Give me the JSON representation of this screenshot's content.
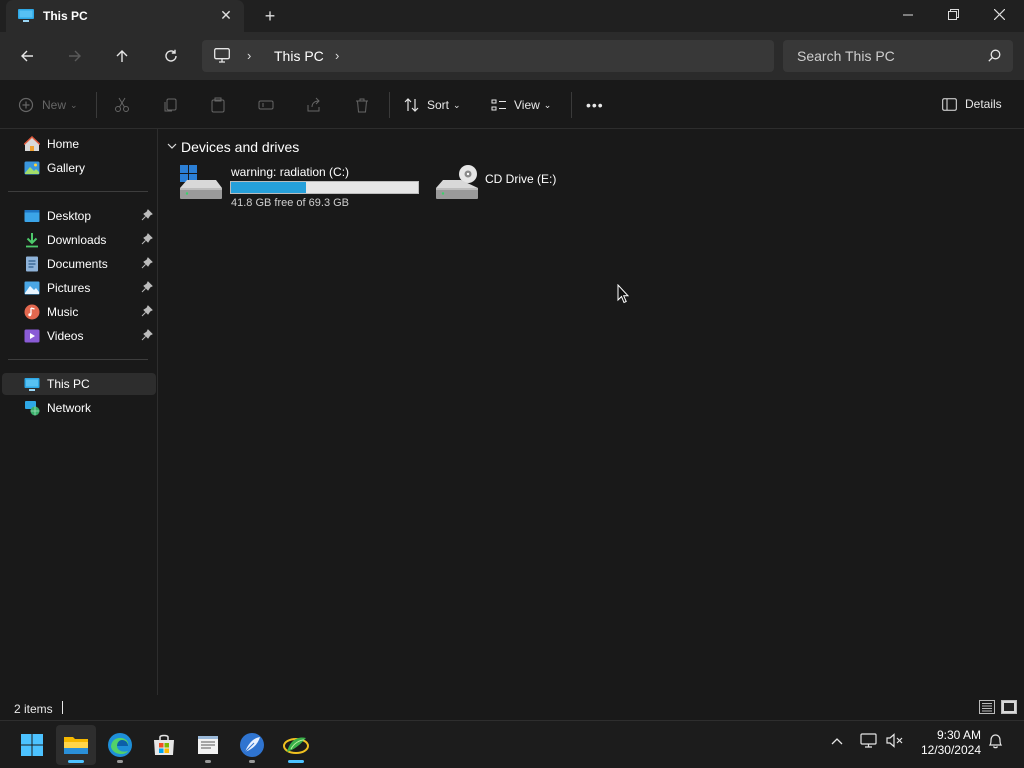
{
  "window": {
    "tab_title": "This PC",
    "tab_close": "✕",
    "new_tab": "+",
    "minimize": "—",
    "restore": "❐",
    "close": "✕"
  },
  "address": {
    "crumb": "This PC",
    "search_placeholder": "Search This PC"
  },
  "commands": {
    "new_label": "New",
    "sort_label": "Sort",
    "view_label": "View",
    "details_label": "Details",
    "more_label": "•••"
  },
  "sidebar": {
    "items": [
      {
        "label": "Home",
        "icon": "home-icon"
      },
      {
        "label": "Gallery",
        "icon": "gallery-icon"
      },
      {
        "label": "Desktop",
        "icon": "desktop-icon",
        "pinned": true
      },
      {
        "label": "Downloads",
        "icon": "downloads-icon",
        "pinned": true
      },
      {
        "label": "Documents",
        "icon": "documents-icon",
        "pinned": true
      },
      {
        "label": "Pictures",
        "icon": "pictures-icon",
        "pinned": true
      },
      {
        "label": "Music",
        "icon": "music-icon",
        "pinned": true
      },
      {
        "label": "Videos",
        "icon": "videos-icon",
        "pinned": true
      },
      {
        "label": "This PC",
        "icon": "this-pc-icon",
        "selected": true
      },
      {
        "label": "Network",
        "icon": "network-icon"
      }
    ]
  },
  "content": {
    "group_title": "Devices and drives",
    "drives": [
      {
        "name": "warning: radiation (C:)",
        "free_text": "41.8 GB free of 69.3 GB",
        "used_fraction": 0.4
      },
      {
        "name": "CD Drive (E:)"
      }
    ]
  },
  "status": {
    "item_count": "2 items"
  },
  "taskbar": {
    "time": "9:30 AM",
    "date": "12/30/2024",
    "apps": [
      "start-icon",
      "file-explorer-icon",
      "edge-icon",
      "store-icon",
      "notepad-icon",
      "feather-app-icon",
      "green-app-icon"
    ]
  },
  "colors": {
    "accent": "#26a0da",
    "background": "#191919",
    "toolbar": "#2b2b2b"
  }
}
